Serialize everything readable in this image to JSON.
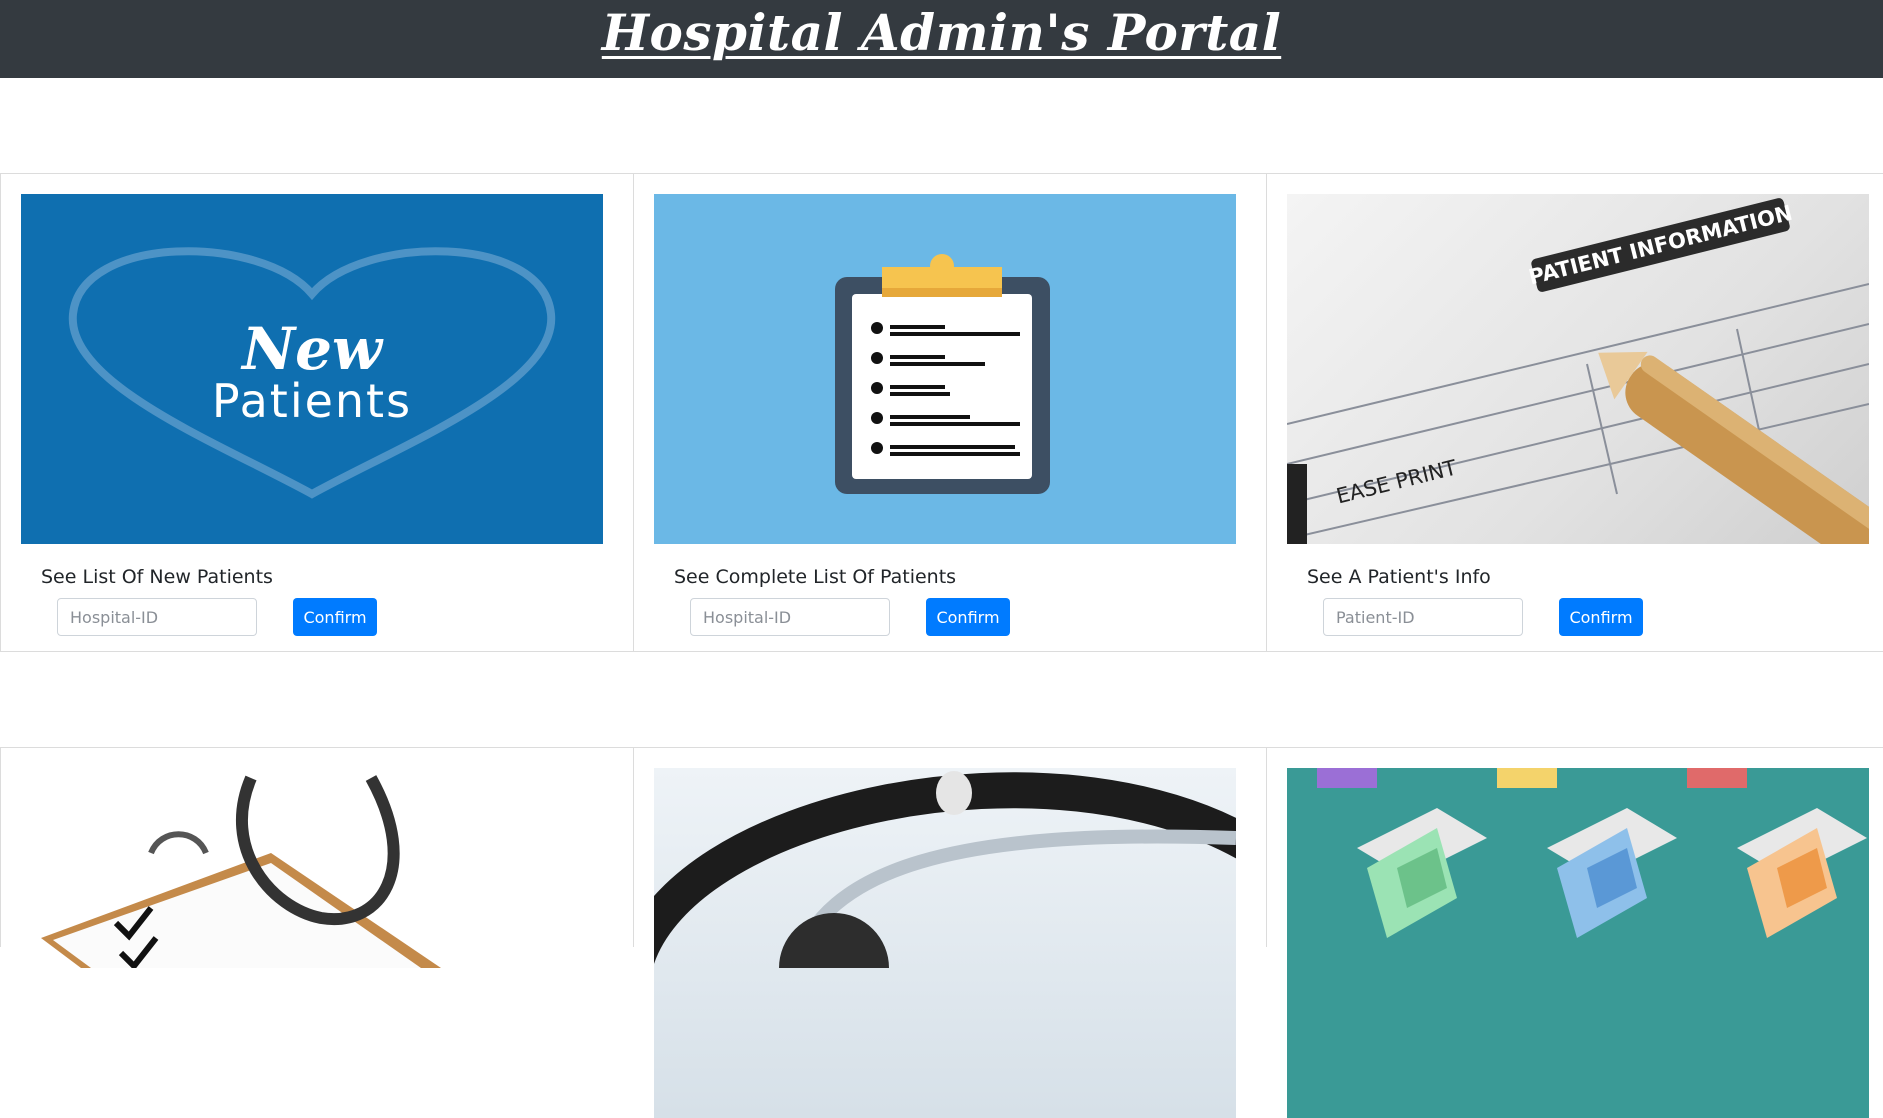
{
  "header": {
    "title": "Hospital Admin's Portal"
  },
  "cards_row1": [
    {
      "image_alt": "New Patients",
      "image_text_line1": "New",
      "image_text_line2": "Patients",
      "title": "See List Of New Patients",
      "input_placeholder": "Hospital-ID",
      "button_label": "Confirm"
    },
    {
      "image_alt": "clipboard-illustration",
      "title": "See Complete List Of Patients",
      "input_placeholder": "Hospital-ID",
      "button_label": "Confirm"
    },
    {
      "image_alt": "patient-information-form",
      "image_text": "PATIENT INFORMATION",
      "image_text2": "EASE PRINT",
      "title": "See A Patient's Info",
      "input_placeholder": "Patient-ID",
      "button_label": "Confirm"
    }
  ],
  "cards_row2": [
    {
      "image_alt": "clipboard-stethoscope"
    },
    {
      "image_alt": "stethoscope-closeup"
    },
    {
      "image_alt": "hospital-beds-pattern"
    }
  ],
  "colors": {
    "header_bg": "#343a40",
    "primary": "#007bff",
    "new_patients_bg": "#0f6fb0",
    "clipboard_bg": "#6bb8e6",
    "beds_bg": "#3a9a96"
  }
}
